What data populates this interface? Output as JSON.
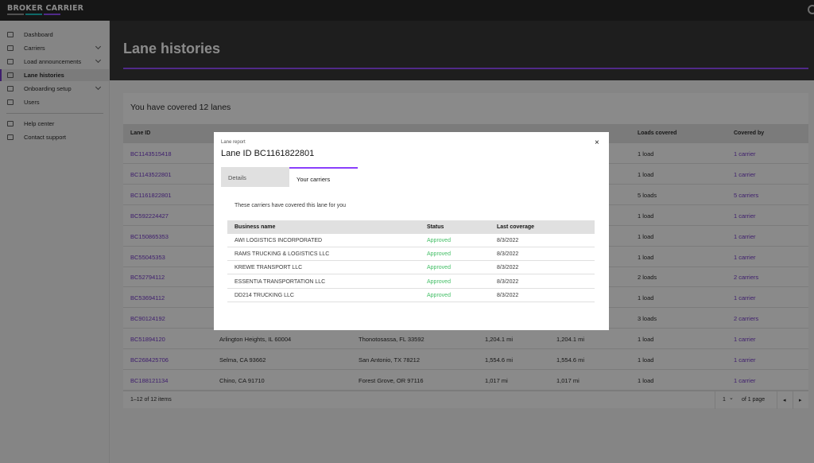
{
  "brand": {
    "name": "BROKER CARRIER",
    "bar_colors": [
      "#8d8d8d",
      "#08bdba",
      "#8a3ffc"
    ]
  },
  "sidebar": {
    "items": [
      {
        "label": "Dashboard",
        "icon": "dashboard-icon",
        "has_chevron": false,
        "active": false
      },
      {
        "label": "Carriers",
        "icon": "truck-icon",
        "has_chevron": true,
        "active": false
      },
      {
        "label": "Load announcements",
        "icon": "megaphone-icon",
        "has_chevron": true,
        "active": false
      },
      {
        "label": "Lane histories",
        "icon": "history-icon",
        "has_chevron": false,
        "active": true
      },
      {
        "label": "Onboarding setup",
        "icon": "clipboard-icon",
        "has_chevron": true,
        "active": false
      },
      {
        "label": "Users",
        "icon": "user-icon",
        "has_chevron": false,
        "active": false
      }
    ],
    "support": [
      {
        "label": "Help center",
        "icon": "external-link-icon"
      },
      {
        "label": "Contact support",
        "icon": "external-link-icon"
      }
    ]
  },
  "header": {
    "title": "Lane histories"
  },
  "main": {
    "summary": "You have covered 12 lanes",
    "columns": [
      "Lane ID",
      "Loads covered",
      "Covered by"
    ],
    "rows": [
      {
        "lane_id": "BC1143515418",
        "origin": "",
        "destination": "",
        "distance": "",
        "total": "",
        "loads": "1 load",
        "covered_by": "1 carrier"
      },
      {
        "lane_id": "BC1143522801",
        "origin": "",
        "destination": "",
        "distance": "",
        "total": "",
        "loads": "1 load",
        "covered_by": "1 carrier"
      },
      {
        "lane_id": "BC1161822801",
        "origin": "",
        "destination": "",
        "distance": "",
        "total": "",
        "loads": "5 loads",
        "covered_by": "5 carriers"
      },
      {
        "lane_id": "BC592224427",
        "origin": "",
        "destination": "",
        "distance": "",
        "total": "",
        "loads": "1 load",
        "covered_by": "1 carrier"
      },
      {
        "lane_id": "BC150865353",
        "origin": "",
        "destination": "",
        "distance": "",
        "total": "",
        "loads": "1 load",
        "covered_by": "1 carrier"
      },
      {
        "lane_id": "BC55045353",
        "origin": "",
        "destination": "",
        "distance": "",
        "total": "",
        "loads": "1 load",
        "covered_by": "1 carrier"
      },
      {
        "lane_id": "BC52794112",
        "origin": "",
        "destination": "",
        "distance": "",
        "total": "",
        "loads": "2 loads",
        "covered_by": "2 carriers"
      },
      {
        "lane_id": "BC53694112",
        "origin": "",
        "destination": "",
        "distance": "",
        "total": "",
        "loads": "1 load",
        "covered_by": "1 carrier"
      },
      {
        "lane_id": "BC90124192",
        "origin": "",
        "destination": "",
        "distance": "",
        "total": "",
        "loads": "3 loads",
        "covered_by": "2 carriers"
      },
      {
        "lane_id": "BC51894120",
        "origin": "Arlington Heights, IL 60004",
        "destination": "Thonotosassa, FL 33592",
        "distance": "1,204.1 mi",
        "total": "1,204.1 mi",
        "loads": "1 load",
        "covered_by": "1 carrier"
      },
      {
        "lane_id": "BC268425706",
        "origin": "Selma, CA 93662",
        "destination": "San Antonio, TX 78212",
        "distance": "1,554.6 mi",
        "total": "1,554.6 mi",
        "loads": "1 load",
        "covered_by": "1 carrier"
      },
      {
        "lane_id": "BC188121134",
        "origin": "Chino, CA 91710",
        "destination": "Forest Grove, OR 97116",
        "distance": "1,017 mi",
        "total": "1,017 mi",
        "loads": "1 load",
        "covered_by": "1 carrier"
      }
    ],
    "pagination": {
      "range": "1–12 of 12 items",
      "page": "1",
      "of_pages": "of 1 page"
    }
  },
  "modal": {
    "label": "Lane report",
    "title": "Lane ID BC1161822801",
    "tabs": [
      "Details",
      "Your carriers"
    ],
    "description": "These carriers have covered this lane for you",
    "columns": [
      "Business name",
      "Status",
      "Last coverage"
    ],
    "rows": [
      {
        "name": "AWI LOGISTICS INCORPORATED",
        "status": "Approved",
        "date": "8/3/2022"
      },
      {
        "name": "RAMS TRUCKING & LOGISTICS LLC",
        "status": "Approved",
        "date": "8/3/2022"
      },
      {
        "name": "KREWE TRANSPORT LLC",
        "status": "Approved",
        "date": "8/3/2022"
      },
      {
        "name": "ESSENTIA TRANSPORTATION LLC",
        "status": "Approved",
        "date": "8/3/2022"
      },
      {
        "name": "DD214 TRUCKING LLC",
        "status": "Approved",
        "date": "8/3/2022"
      }
    ],
    "close_glyph": "×"
  }
}
